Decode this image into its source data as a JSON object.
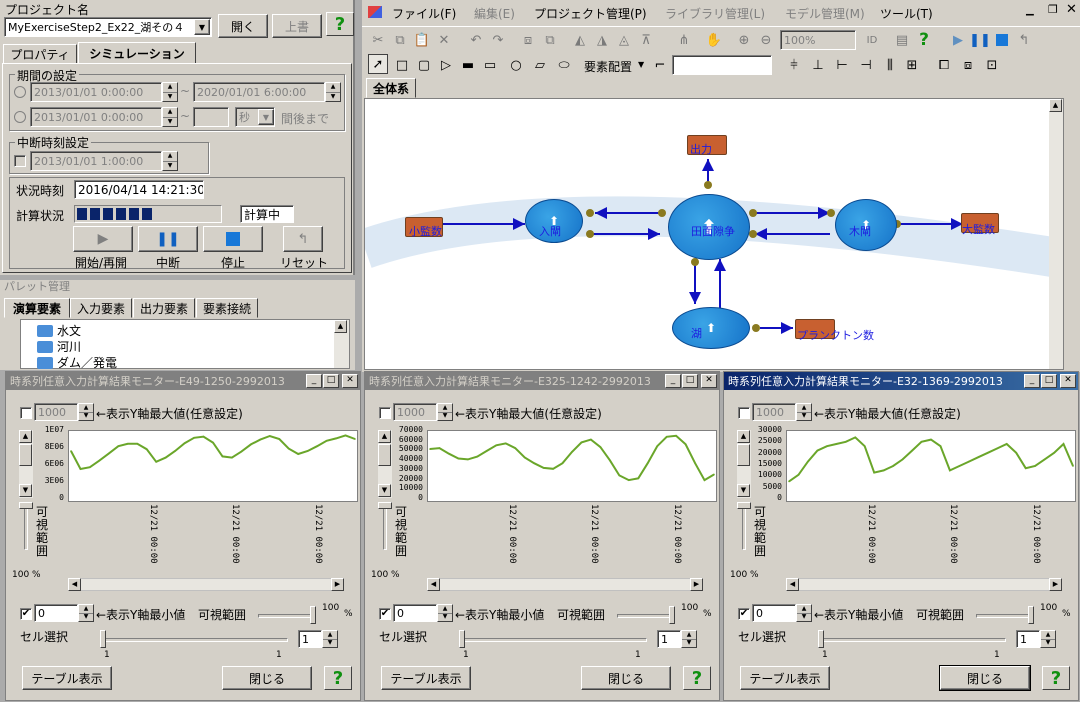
{
  "project": {
    "title": "プロジェクト名",
    "name": "MyExerciseStep2_Ex22_湖その４",
    "open_button": "開く",
    "overwrite_button": "上書",
    "tabs": [
      "プロパティ",
      "シミュレーション"
    ],
    "period_group": "期間の設定",
    "start1": "2013/01/01  0:00:00",
    "end1": "2020/01/01  6:00:00",
    "start2": "2013/01/01  0:00:00",
    "unit": "秒",
    "until": "間後まで",
    "tilde": "~",
    "interrupt_group": "中断時刻設定",
    "interrupt_time": "2013/01/01  1:00:00",
    "status_time_label": "状況時刻",
    "status_time": "2016/04/14 14:21:30",
    "calc_status_label": "計算状況",
    "calc_status": "計算中",
    "progress": 0.55,
    "buttons": [
      "開始/再開",
      "中断",
      "停止",
      "リセット"
    ]
  },
  "palette": {
    "title": "パレット管理",
    "tabs": [
      "演算要素",
      "入力要素",
      "出力要素",
      "要素接続"
    ],
    "tree": [
      "水文",
      "河川",
      "ダム／発電"
    ]
  },
  "main": {
    "menu": [
      "ファイル(F)",
      "編集(E)",
      "プロジェクト管理(P)",
      "ライブラリ管理(L)",
      "モデル管理(M)",
      "ツール(T)"
    ],
    "zoom": "100%",
    "layout_label": "要素配置",
    "tab": "全体系",
    "nodes": {
      "out_top": "出力",
      "left_in": "小監数",
      "node_a": "入閘",
      "center": "田面隙争",
      "node_b": "木閘",
      "right_out": "大監数",
      "lake": "湖",
      "plankton": "プランクトン数"
    }
  },
  "monitors": [
    {
      "title": "時系列任意入力計算結果モニター-E49-1250-2992013",
      "ymax": "1000",
      "ymax_label": "←表示Y軸最大値(任意設定)",
      "yticks": [
        "1E07",
        "8E06",
        "6E06",
        "3E06",
        "0"
      ],
      "xticks": [
        "12/21 00:00",
        "12/21 00:00",
        "12/21 00:00"
      ],
      "range_label": "可視範囲",
      "pct": "100 %",
      "ymin": "0",
      "ymin_label": "←表示Y軸最小値",
      "visible_range": "可視範囲",
      "pct100": "100",
      "pct_sign": "%",
      "cell_label": "セル選択",
      "cell": "1",
      "one": "1",
      "table_button": "テーブル表示",
      "close_button": "閉じる",
      "active": false
    },
    {
      "title": "時系列任意入力計算結果モニター-E325-1242-2992013",
      "ymax": "1000",
      "ymax_label": "←表示Y軸最大値(任意設定)",
      "yticks": [
        "70000",
        "60000",
        "50000",
        "40000",
        "30000",
        "20000",
        "10000",
        "0"
      ],
      "xticks": [
        "12/21 00:00",
        "12/21 00:00",
        "12/21 00:00"
      ],
      "range_label": "可視範囲",
      "pct": "100 %",
      "ymin": "0",
      "ymin_label": "←表示Y軸最小値",
      "visible_range": "可視範囲",
      "pct100": "100",
      "pct_sign": "%",
      "cell_label": "セル選択",
      "cell": "1",
      "one": "1",
      "table_button": "テーブル表示",
      "close_button": "閉じる",
      "active": false
    },
    {
      "title": "時系列任意入力計算結果モニター-E32-1369-2992013",
      "ymax": "1000",
      "ymax_label": "←表示Y軸最大値(任意設定)",
      "yticks": [
        "30000",
        "25000",
        "20000",
        "15000",
        "10000",
        "5000",
        "0"
      ],
      "xticks": [
        "12/21 00:00",
        "12/21 00:00",
        "12/21 00:00"
      ],
      "range_label": "可視範囲",
      "pct": "100 %",
      "ymin": "0",
      "ymin_label": "←表示Y軸最小値",
      "visible_range": "可視範囲",
      "pct100": "100",
      "pct_sign": "%",
      "cell_label": "セル選択",
      "cell": "1",
      "one": "1",
      "table_button": "テーブル表示",
      "close_button": "閉じる",
      "active": true
    }
  ],
  "chart_data": [
    {
      "type": "line",
      "ylim": [
        0,
        11000000
      ],
      "y": [
        8000000,
        5000000,
        5300000,
        6400000,
        7600000,
        8800000,
        9200000,
        9200000,
        8300000,
        6200000,
        6900000,
        8000000,
        9300000,
        10200000,
        10400000,
        9400000,
        7100000,
        6900000,
        7900000,
        9100000,
        9900000,
        10500000,
        10000000,
        8400000,
        7500000,
        8000000,
        8800000,
        9700000,
        10100000,
        10600000,
        10000000
      ],
      "color": "#6aa62a"
    },
    {
      "type": "line",
      "ylim": [
        0,
        70000
      ],
      "y": [
        53000,
        54000,
        48000,
        43000,
        42000,
        45000,
        51000,
        57000,
        59000,
        54000,
        44000,
        38000,
        33000,
        32000,
        38000,
        50000,
        60000,
        63000,
        55000,
        41000,
        25000,
        20000,
        22000,
        38000,
        56000,
        66000,
        67000,
        58000,
        38000,
        20000,
        26000
      ],
      "color": "#6aa62a"
    },
    {
      "type": "line",
      "ylim": [
        0,
        30000
      ],
      "y": [
        8000,
        11000,
        17000,
        22000,
        24000,
        25000,
        26000,
        28000,
        24000,
        12000,
        13000,
        15000,
        18000,
        22000,
        26000,
        27000,
        24000,
        13000,
        15000,
        17000,
        19000,
        21000,
        23000,
        25000,
        21000,
        14000,
        15000,
        18000,
        21000,
        25000,
        15000
      ],
      "color": "#6aa62a"
    }
  ]
}
